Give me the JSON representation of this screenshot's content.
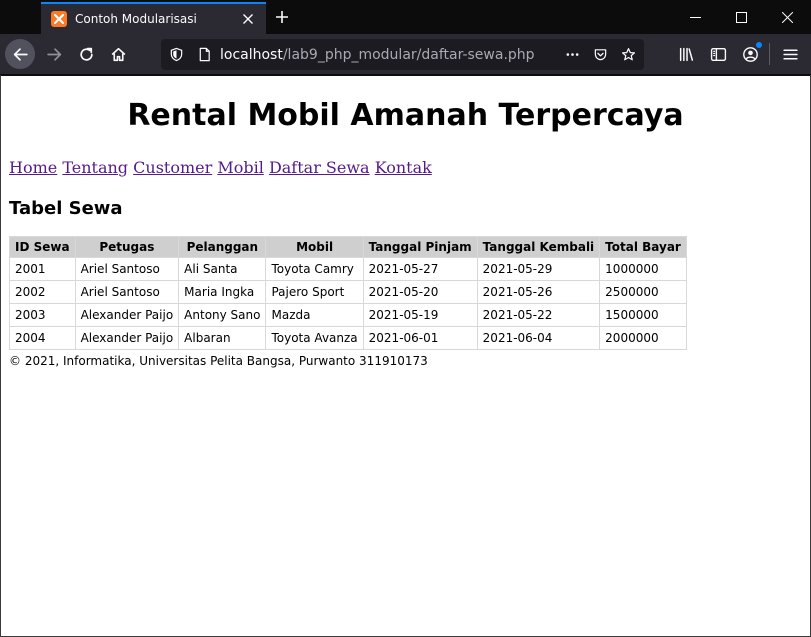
{
  "browser": {
    "tab_title": "Contoh Modularisasi",
    "url_host": "localhost",
    "url_path": "/lab9_php_modular/daftar-sewa.php",
    "colors": {
      "accent": "#0a84ff",
      "favicon": "#fb7a24"
    }
  },
  "page": {
    "site_title": "Rental Mobil Amanah Terpercaya",
    "nav": [
      "Home",
      "Tentang",
      "Customer",
      "Mobil",
      "Daftar Sewa",
      "Kontak"
    ],
    "section_title": "Tabel Sewa",
    "table": {
      "headers": [
        "ID Sewa",
        "Petugas",
        "Pelanggan",
        "Mobil",
        "Tanggal Pinjam",
        "Tanggal Kembali",
        "Total Bayar"
      ],
      "rows": [
        [
          "2001",
          "Ariel Santoso",
          "Ali Santa",
          "Toyota Camry",
          "2021-05-27",
          "2021-05-29",
          "1000000"
        ],
        [
          "2002",
          "Ariel Santoso",
          "Maria Ingka",
          "Pajero Sport",
          "2021-05-20",
          "2021-05-26",
          "2500000"
        ],
        [
          "2003",
          "Alexander Paijo",
          "Antony Sano",
          "Mazda",
          "2021-05-19",
          "2021-05-22",
          "1500000"
        ],
        [
          "2004",
          "Alexander Paijo",
          "Albaran",
          "Toyota Avanza",
          "2021-06-01",
          "2021-06-04",
          "2000000"
        ]
      ]
    },
    "footer": "© 2021, Informatika, Universitas Pelita Bangsa, Purwanto 311910173"
  }
}
